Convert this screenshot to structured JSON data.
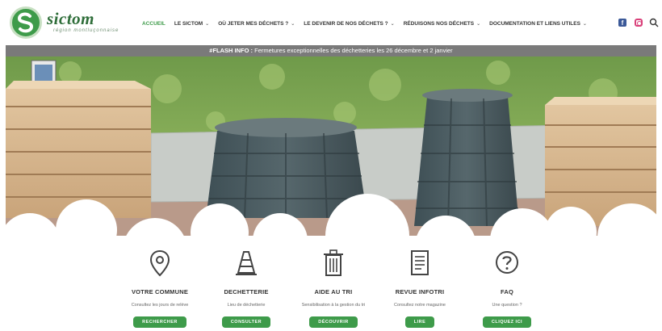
{
  "brand": {
    "name": "sictom",
    "tagline": "région montluçonnaise"
  },
  "nav": {
    "items": [
      {
        "label": "ACCUEIL",
        "active": true,
        "dropdown": false
      },
      {
        "label": "LE SICTOM",
        "active": false,
        "dropdown": true
      },
      {
        "label": "OÙ JETER MES DÉCHETS ?",
        "active": false,
        "dropdown": true
      },
      {
        "label": "LE DEVENIR DE NOS DÉCHETS ?",
        "active": false,
        "dropdown": true
      },
      {
        "label": "RÉDUISONS NOS DÉCHETS",
        "active": false,
        "dropdown": true
      },
      {
        "label": "DOCUMENTATION ET LIENS UTILES",
        "active": false,
        "dropdown": true
      }
    ],
    "social": [
      "facebook-icon",
      "instagram-icon"
    ],
    "search_icon": "search-icon"
  },
  "flash": {
    "prefix": "#FLASH INFO :",
    "text": " Fermetures exceptionnelles des déchetteries les 26 décembre et 2 janvier"
  },
  "cards": [
    {
      "icon": "map-pin-icon",
      "title": "VOTRE COMMUNE",
      "desc": "Consultez les jours de relève",
      "button": "RECHERCHER"
    },
    {
      "icon": "traffic-cone-icon",
      "title": "DECHETTERIE",
      "desc": "Lieu de déchetterie",
      "button": "CONSULTER"
    },
    {
      "icon": "trash-bin-icon",
      "title": "AIDE AU TRI",
      "desc": "Sensibilisation à la gestion du tri",
      "button": "DÉCOUVRIR"
    },
    {
      "icon": "document-icon",
      "title": "REVUE INFOTRI",
      "desc": "Consultez notre magazine",
      "button": "LIRE"
    },
    {
      "icon": "question-icon",
      "title": "FAQ",
      "desc": "Une question ?",
      "button": "CLIQUEZ ICI"
    }
  ],
  "colors": {
    "brand_green": "#3e9b4a",
    "flash_bg": "#7a7a7a",
    "text_dark": "#333333"
  }
}
